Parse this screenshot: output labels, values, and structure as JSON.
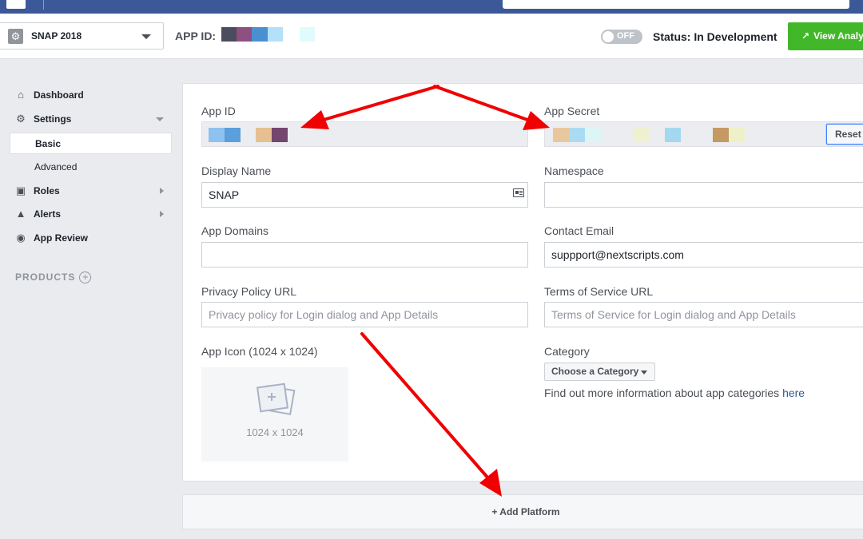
{
  "header": {
    "app_name": "SNAP 2018",
    "app_id_label": "APP ID:",
    "toggle_label": "OFF",
    "status": "Status: In Development",
    "view_analytics": "View Analy"
  },
  "sidebar": {
    "items": [
      {
        "label": "Dashboard"
      },
      {
        "label": "Settings"
      },
      {
        "label": "Basic"
      },
      {
        "label": "Advanced"
      },
      {
        "label": "Roles"
      },
      {
        "label": "Alerts"
      },
      {
        "label": "App Review"
      }
    ],
    "products_label": "PRODUCTS"
  },
  "form": {
    "app_id_label": "App ID",
    "app_secret_label": "App Secret",
    "reset_label": "Reset",
    "display_name_label": "Display Name",
    "display_name_value": "SNAP",
    "namespace_label": "Namespace",
    "namespace_value": "",
    "app_domains_label": "App Domains",
    "app_domains_value": "",
    "contact_email_label": "Contact Email",
    "contact_email_value": "suppport@nextscripts.com",
    "privacy_label": "Privacy Policy URL",
    "privacy_placeholder": "Privacy policy for Login dialog and App Details",
    "tos_label": "Terms of Service URL",
    "tos_placeholder": "Terms of Service for Login dialog and App Details",
    "app_icon_label": "App Icon (1024 x 1024)",
    "app_icon_caption": "1024 x 1024",
    "category_label": "Category",
    "category_button": "Choose a Category",
    "category_info": "Find out more information about app categories",
    "category_link": "here"
  },
  "add_platform": "+ Add Platform",
  "colors": {
    "topbar": "#3b5998",
    "green_button": "#42b72a",
    "annotation_arrow": "#f00000",
    "link": "#365899"
  }
}
